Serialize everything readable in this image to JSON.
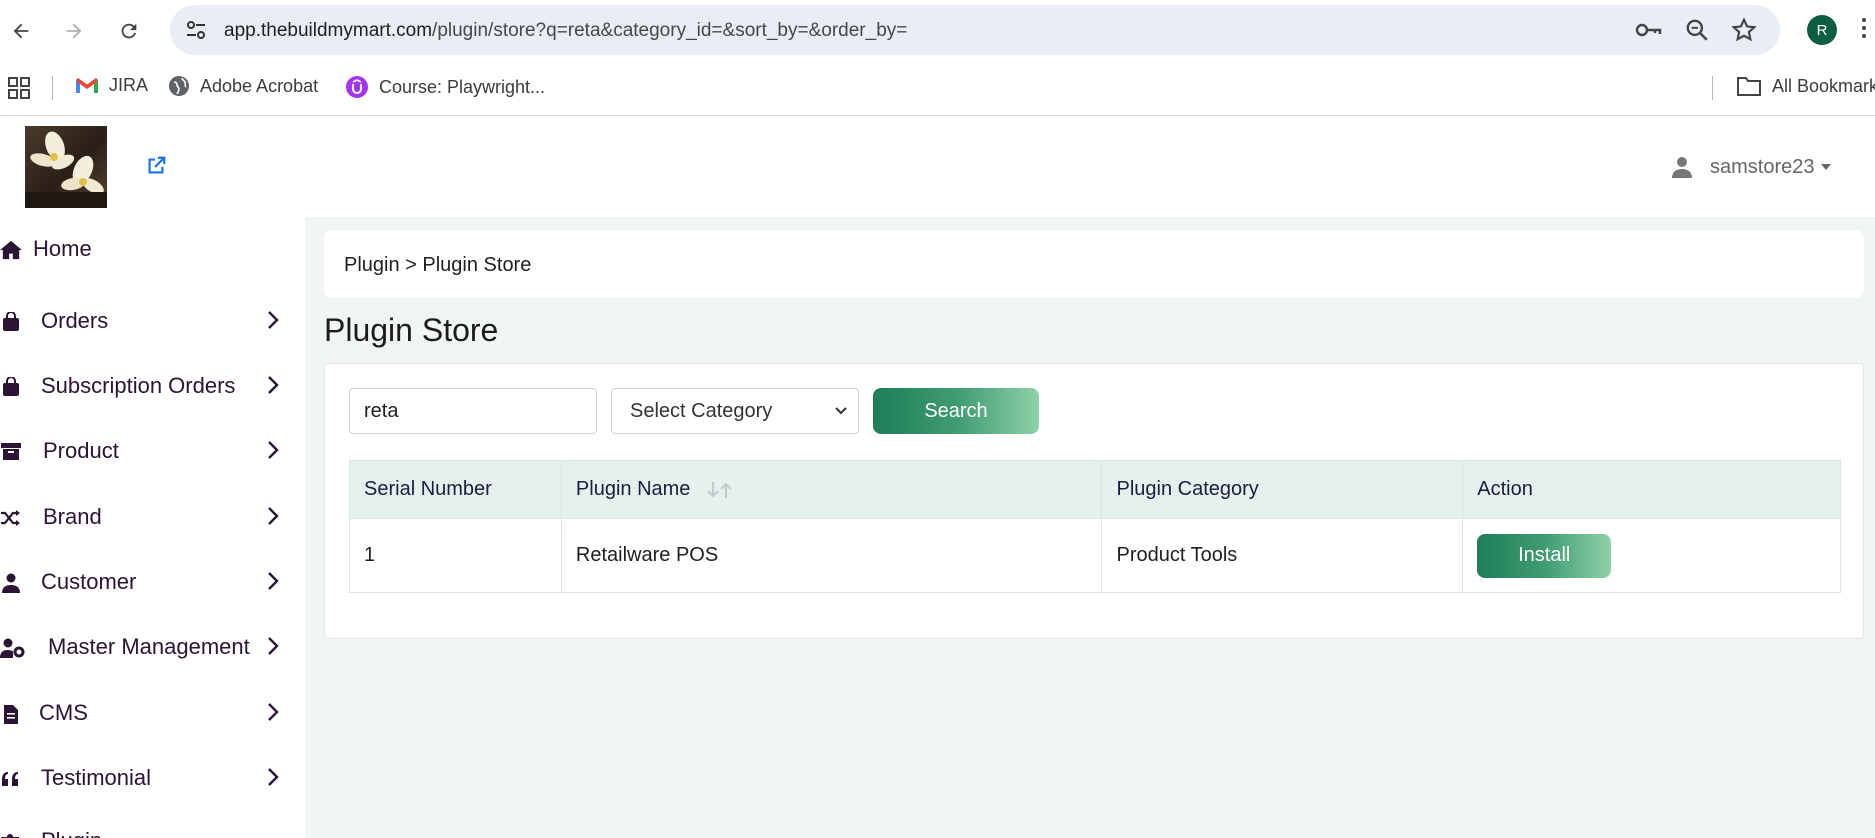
{
  "browser": {
    "url_host": "app.thebuildmymart.com",
    "url_path": "/plugin/store?q=reta&category_id=&sort_by=&order_by=",
    "profile_initial": "R",
    "bookmarks": [
      {
        "label": "JIRA",
        "icon": "gmail-icon"
      },
      {
        "label": "Adobe Acrobat",
        "icon": "globe-icon"
      },
      {
        "label": "Course: Playwright...",
        "icon": "udemy-icon"
      }
    ],
    "all_bookmarks_label": "All Bookmark"
  },
  "header": {
    "username": "samstore23"
  },
  "sidebar": {
    "items": [
      {
        "label": "Home",
        "icon": "home-icon",
        "has_chevron": false
      },
      {
        "label": "Orders",
        "icon": "shopping-bag-icon",
        "has_chevron": true
      },
      {
        "label": "Subscription Orders",
        "icon": "shopping-bag-icon",
        "has_chevron": true
      },
      {
        "label": "Product",
        "icon": "archive-box-icon",
        "has_chevron": true
      },
      {
        "label": "Brand",
        "icon": "shuffle-icon",
        "has_chevron": true
      },
      {
        "label": "Customer",
        "icon": "user-icon",
        "has_chevron": true
      },
      {
        "label": "Master Management",
        "icon": "user-gear-icon",
        "has_chevron": true
      },
      {
        "label": "CMS",
        "icon": "file-icon",
        "has_chevron": true
      },
      {
        "label": "Testimonial",
        "icon": "quote-icon",
        "has_chevron": true
      },
      {
        "label": "Plugin",
        "icon": "puzzle-icon",
        "has_chevron": false
      }
    ]
  },
  "main": {
    "breadcrumb": "Plugin > Plugin Store",
    "page_title": "Plugin Store",
    "search_value": "reta",
    "category_select": "Select Category",
    "search_button": "Search",
    "table": {
      "headers": [
        "Serial Number",
        "Plugin Name",
        "Plugin Category",
        "Action"
      ],
      "rows": [
        {
          "serial": "1",
          "name": "Retailware POS",
          "category": "Product Tools",
          "action": "Install"
        }
      ]
    }
  },
  "colors": {
    "accent_dark": "#1e7e58",
    "accent_light": "#8fd1a8",
    "sidebar_text": "#2b1436",
    "table_header_bg": "#e6f1ee"
  }
}
